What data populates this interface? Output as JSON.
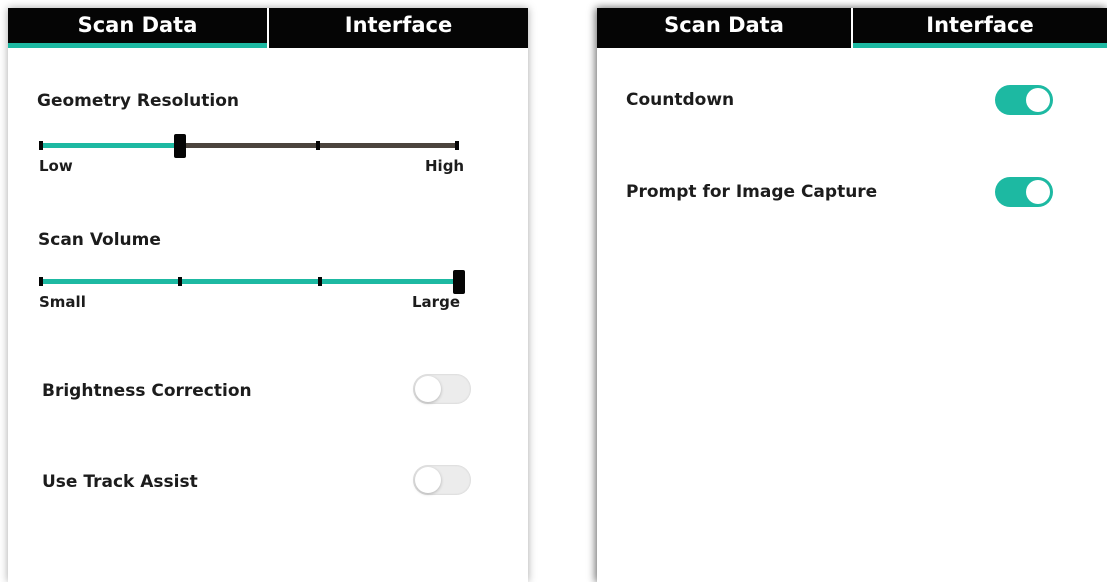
{
  "colors": {
    "accent": "#1db9a2",
    "tab_bar": "#050505",
    "track_inactive": "#4b443d"
  },
  "left_panel": {
    "tabs": [
      {
        "label": "Scan Data",
        "active": true
      },
      {
        "label": "Interface",
        "active": false
      }
    ],
    "geometry_resolution": {
      "label": "Geometry Resolution",
      "min_label": "Low",
      "max_label": "High",
      "steps": 4,
      "value_index": 1
    },
    "scan_volume": {
      "label": "Scan Volume",
      "min_label": "Small",
      "max_label": "Large",
      "steps": 4,
      "value_index": 3
    },
    "toggles": [
      {
        "label": "Brightness Correction",
        "on": false
      },
      {
        "label": "Use Track Assist",
        "on": false
      }
    ]
  },
  "right_panel": {
    "tabs": [
      {
        "label": "Scan Data",
        "active": false
      },
      {
        "label": "Interface",
        "active": true
      }
    ],
    "toggles": [
      {
        "label": "Countdown",
        "on": true
      },
      {
        "label": "Prompt for Image Capture",
        "on": true
      }
    ]
  }
}
